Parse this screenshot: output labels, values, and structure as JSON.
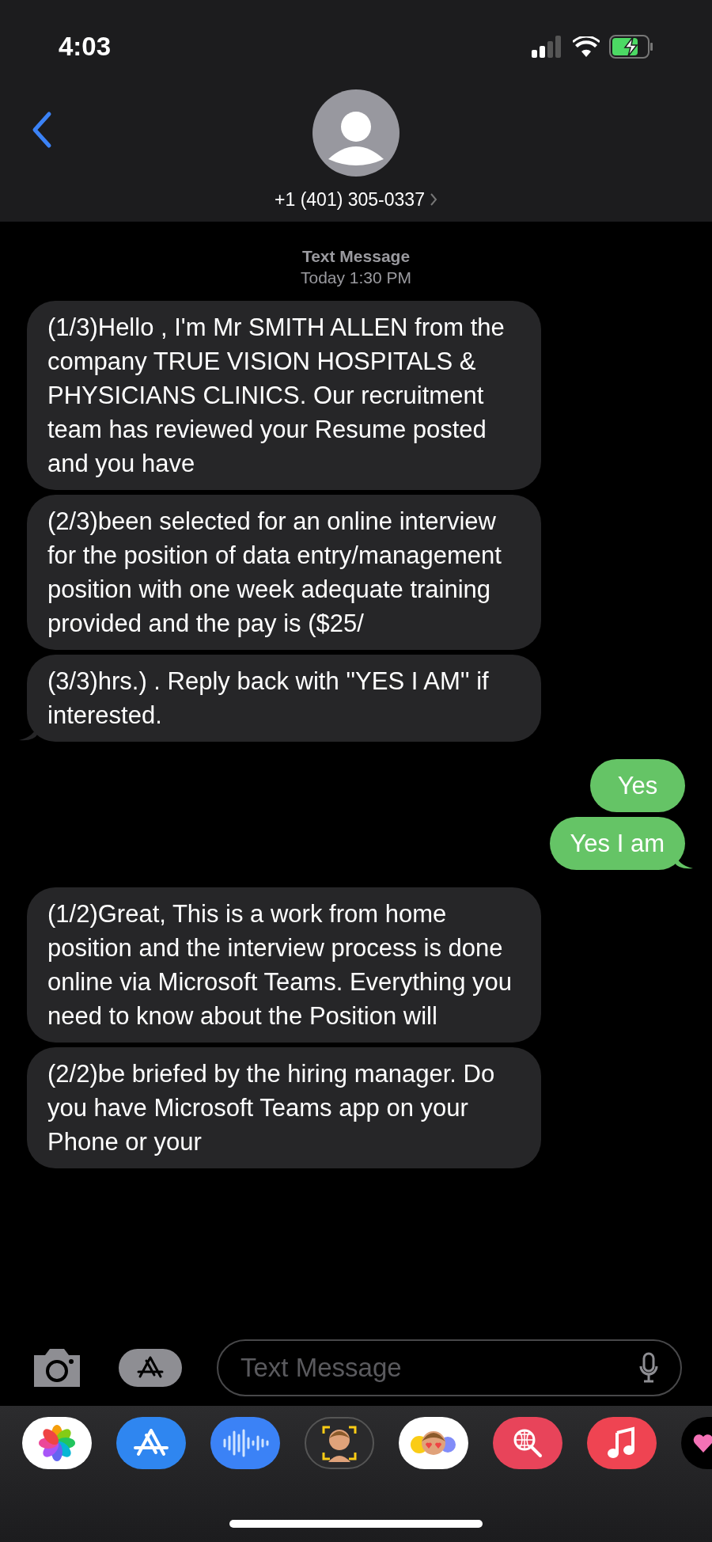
{
  "status_bar": {
    "time": "4:03"
  },
  "header": {
    "contact": "+1 (401) 305-0337"
  },
  "conversation": {
    "service": "Text Message",
    "timestamp": "Today 1:30 PM",
    "messages": [
      {
        "kind": "received",
        "text": "(1/3)Hello , I'm Mr SMITH ALLEN from the company TRUE VISION HOSPITALS & PHYSICIANS CLINICS. Our recruitment team has reviewed your Resume posted and you have",
        "tail": false
      },
      {
        "kind": "received",
        "text": "(2/3)been selected for an online interview for the position of data entry/management position with one week adequate training provided and the pay is ($25/",
        "tail": false
      },
      {
        "kind": "received",
        "text": "(3/3)hrs.) . Reply back with ''YES I AM'' if interested.",
        "tail": true
      },
      {
        "kind": "sent",
        "text": "Yes",
        "tail": false
      },
      {
        "kind": "sent",
        "text": "Yes I am",
        "tail": true
      },
      {
        "kind": "received",
        "text": "(1/2)Great, This is a work from home position and the interview process is done online via Microsoft Teams. Everything you need to know about the Position will",
        "tail": false
      },
      {
        "kind": "received",
        "text": "(2/2)be briefed by the hiring manager. Do you have Microsoft Teams app on your Phone or your",
        "tail": false
      }
    ]
  },
  "composer": {
    "placeholder": "Text Message"
  }
}
